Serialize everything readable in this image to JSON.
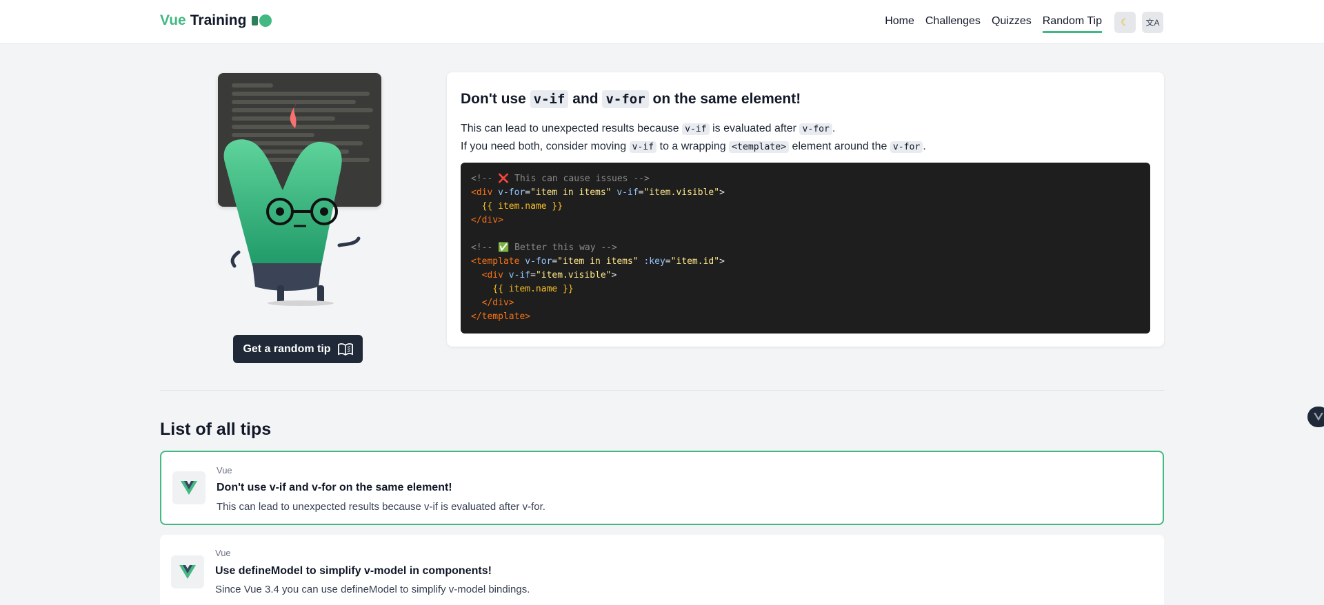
{
  "header": {
    "logo_vue": "Vue",
    "logo_training": "Training",
    "nav": [
      {
        "label": "Home",
        "active": false
      },
      {
        "label": "Challenges",
        "active": false
      },
      {
        "label": "Quizzes",
        "active": false
      },
      {
        "label": "Random Tip",
        "active": true
      }
    ],
    "theme_icon": "moon-icon",
    "lang_icon": "translate-icon"
  },
  "hero": {
    "random_button": "Get a random tip",
    "random_icon": "book-icon"
  },
  "tip": {
    "title_prefix": "Don't use",
    "title_code1": "v-if",
    "title_and": "and",
    "title_code2": "v-for",
    "title_suffix": "on the same element!",
    "line1_a": "This can lead to unexpected results because",
    "line1_code1": "v-if",
    "line1_b": "is evaluated after",
    "line1_code2": "v-for",
    "line1_c": ".",
    "line2_a": "If you need both, consider moving",
    "line2_code1": "v-if",
    "line2_b": "to a wrapping",
    "line2_code2": "<template>",
    "line2_c": "element around the",
    "line2_code3": "v-for",
    "line2_d": ".",
    "code": {
      "c1": "<!-- ❌ This can cause issues -->",
      "c2": "<!-- ✅ Better this way -->",
      "div_open": "<div",
      "div_close": "</div>",
      "template_open": "<template",
      "template_close": "</template>",
      "attr_vfor": "v-for",
      "attr_vif": "v-if",
      "attr_key": ":key",
      "str_items": "\"item in items\"",
      "str_visible": "\"item.visible\"",
      "str_id": "\"item.id\"",
      "interp": "{{ item.name }}"
    }
  },
  "list": {
    "heading": "List of all tips",
    "items": [
      {
        "category": "Vue",
        "title": "Don't use v-if and v-for on the same element!",
        "description": "This can lead to unexpected results because v-if is evaluated after v-for."
      },
      {
        "category": "Vue",
        "title": "Use defineModel to simplify v-model in components!",
        "description": "Since Vue 3.4 you can use defineModel to simplify v-model bindings."
      }
    ]
  },
  "colors": {
    "accent": "#42b883",
    "dark": "#1f2937",
    "code_bg": "#1e1e1e"
  }
}
